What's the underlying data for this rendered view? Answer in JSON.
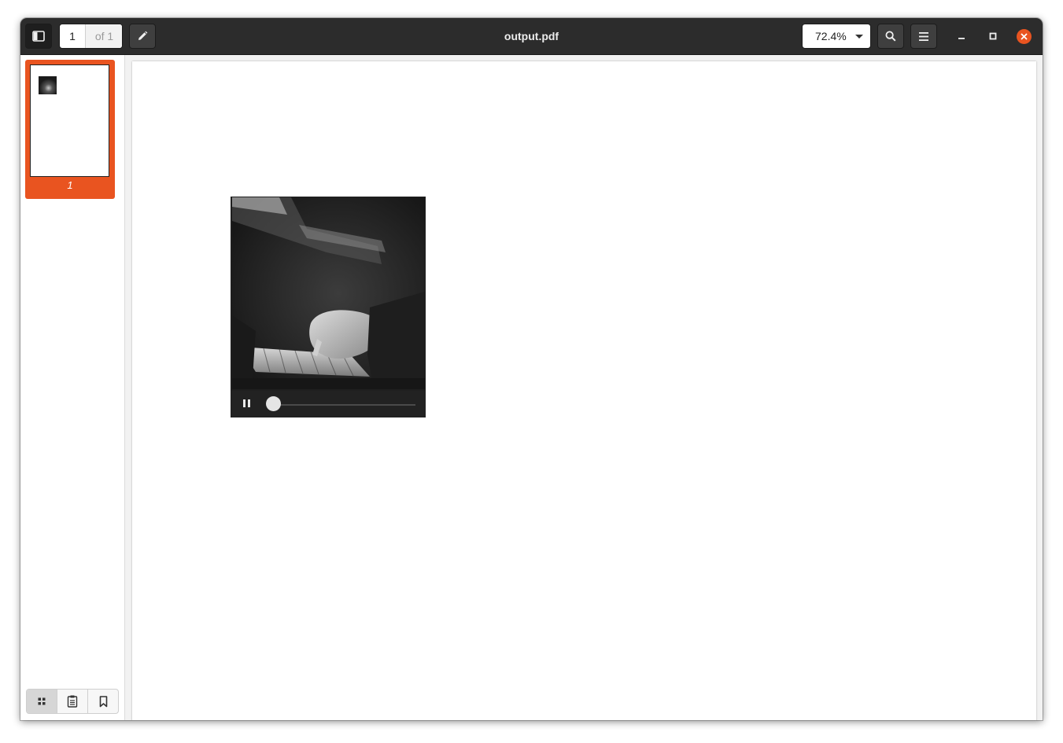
{
  "window": {
    "title": "output.pdf",
    "page_number": "1",
    "page_total": "of 1",
    "zoom": "72.4%"
  },
  "toolbar": {
    "sidebar_toggle_icon": "sidebar-icon",
    "annotate_icon": "pencil-icon",
    "search_icon": "search-icon",
    "menu_icon": "hamburger-icon",
    "minimize_icon": "minimize-icon",
    "maximize_icon": "maximize-icon",
    "close_icon": "close-icon"
  },
  "sidebar": {
    "thumbnails": [
      {
        "label": "1",
        "selected": true
      }
    ],
    "views": [
      {
        "icon": "thumbnails-icon",
        "active": true
      },
      {
        "icon": "outline-icon",
        "active": false
      },
      {
        "icon": "bookmark-icon",
        "active": false
      }
    ]
  },
  "media": {
    "progress": 0,
    "state_icon": "pause-icon"
  },
  "colors": {
    "accent": "#e95420",
    "titlebar": "#2c2c2c"
  }
}
